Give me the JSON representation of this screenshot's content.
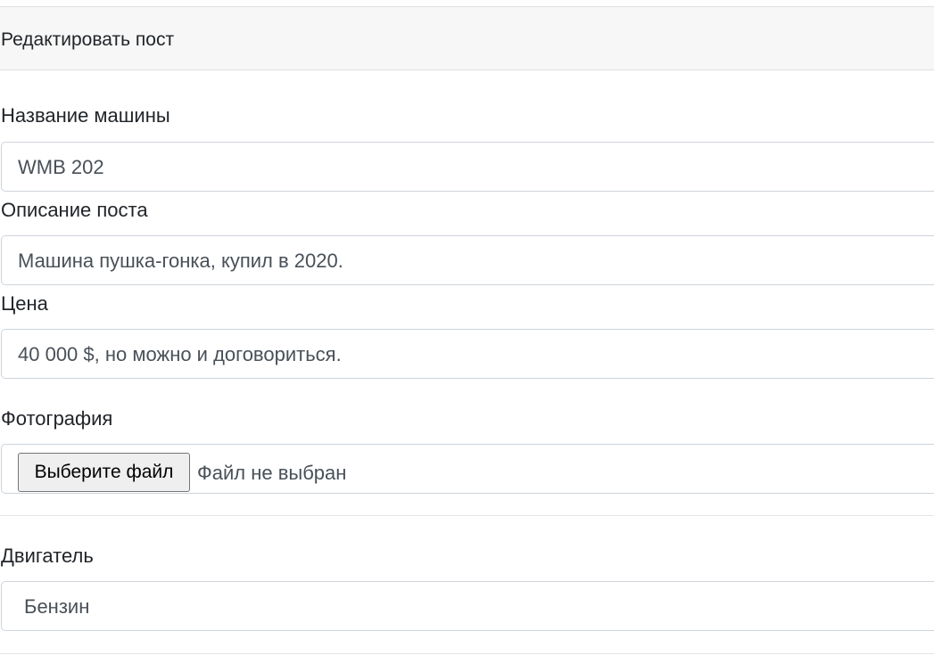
{
  "header": {
    "title": "Редактировать пост"
  },
  "form": {
    "car_name": {
      "label": "Название машины",
      "value": "WMB 202"
    },
    "description": {
      "label": "Описание поста",
      "value": "Машина пушка-гонка, купил в 2020."
    },
    "price": {
      "label": "Цена",
      "value": "40 000 $, но можно и договориться."
    },
    "photo": {
      "label": "Фотография",
      "button_label": "Выберите файл",
      "status": "Файл не выбран"
    },
    "engine": {
      "label": "Двигатель",
      "selected": "Бензин"
    }
  }
}
